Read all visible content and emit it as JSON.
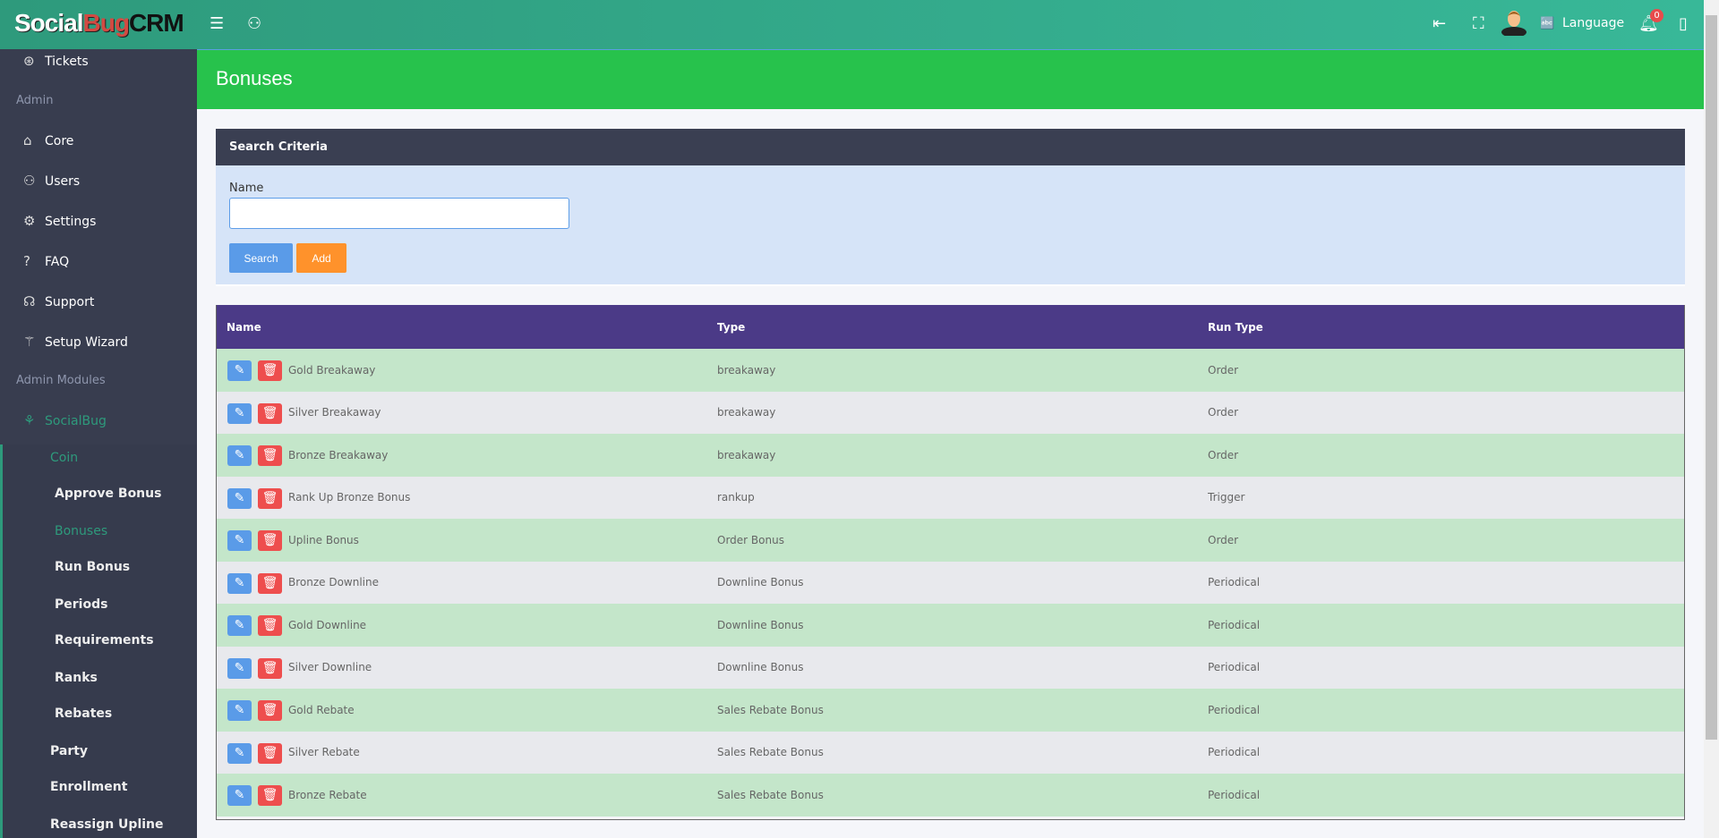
{
  "header": {
    "logo": {
      "a": "Soc",
      "b": "ial",
      "c": "Bug",
      "d": "CRM"
    },
    "language_label": "Language",
    "notification_count": "0",
    "icons": [
      "menu-icon",
      "user-icon",
      "logout-icon",
      "fullscreen-icon",
      "avatar",
      "language-icon",
      "bell-icon",
      "notebook-icon"
    ]
  },
  "sidebar": {
    "tickets": "Tickets",
    "admin_section": "Admin",
    "admin_items": [
      "Core",
      "Users",
      "Settings",
      "FAQ",
      "Support",
      "Setup Wizard"
    ],
    "modules_section": "Admin Modules",
    "socialbug": "SocialBug",
    "coin": "Coin",
    "coin_items": [
      "Approve Bonus",
      "Bonuses",
      "Run Bonus",
      "Periods",
      "Requirements",
      "Ranks",
      "Rebates"
    ],
    "other_items": [
      "Party",
      "Enrollment",
      "Reassign Upline"
    ],
    "active_item": "Bonuses"
  },
  "page": {
    "title": "Bonuses"
  },
  "search": {
    "title": "Search Criteria",
    "name_label": "Name",
    "name_value": "",
    "search_button": "Search",
    "add_button": "Add"
  },
  "table": {
    "columns": [
      "Name",
      "Type",
      "Run Type"
    ],
    "rows": [
      [
        "Gold Breakaway",
        "breakaway",
        "Order"
      ],
      [
        "Silver Breakaway",
        "breakaway",
        "Order"
      ],
      [
        "Bronze Breakaway",
        "breakaway",
        "Order"
      ],
      [
        "Rank Up Bronze Bonus",
        "rankup",
        "Trigger"
      ],
      [
        "Upline Bonus",
        "Order Bonus",
        "Order"
      ],
      [
        "Bronze Downline",
        "Downline Bonus",
        "Periodical"
      ],
      [
        "Gold Downline",
        "Downline Bonus",
        "Periodical"
      ],
      [
        "Silver Downline",
        "Downline Bonus",
        "Periodical"
      ],
      [
        "Gold Rebate",
        "Sales Rebate Bonus",
        "Periodical"
      ],
      [
        "Silver Rebate",
        "Sales Rebate Bonus",
        "Periodical"
      ],
      [
        "Bronze Rebate",
        "Sales Rebate Bonus",
        "Periodical"
      ]
    ]
  },
  "colors": {
    "topbar": "#2e9a7c",
    "title_bar": "#27c24c",
    "table_header": "#4b3a87",
    "row_green": "#c4e6ca",
    "edit": "#5a9be8",
    "delete": "#ee4e4e",
    "add": "#ff922b"
  }
}
